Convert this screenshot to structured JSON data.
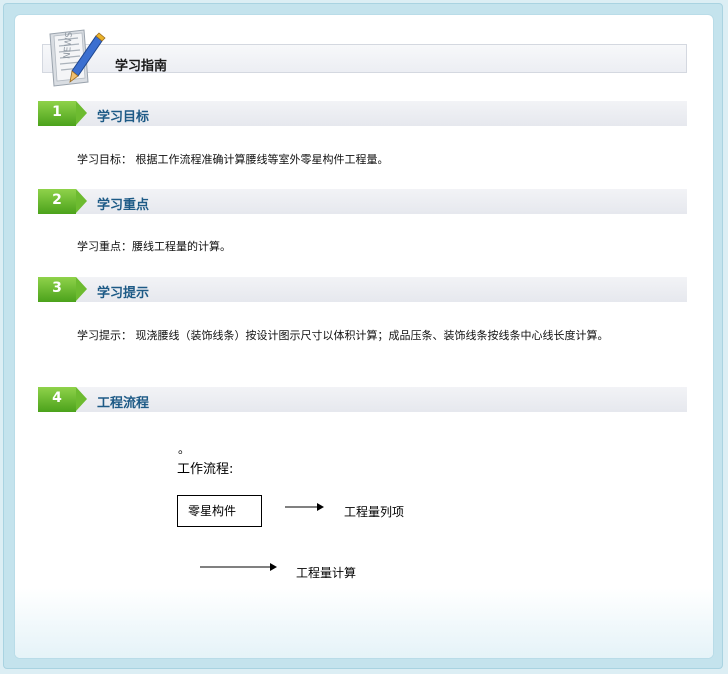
{
  "header": {
    "title": "学习指南",
    "icon": "news-pencil-icon"
  },
  "sections": [
    {
      "num": "1",
      "title": "学习目标",
      "text": "学习目标： 根据工作流程准确计算腰线等室外零星构件工程量。"
    },
    {
      "num": "2",
      "title": "学习重点",
      "text": "学习重点：腰线工程量的计算。"
    },
    {
      "num": "3",
      "title": "学习提示",
      "text": "学习提示： 现浇腰线（装饰线条）按设计图示尺寸以体积计算；成品压条、装饰线条按线条中心线长度计算。"
    },
    {
      "num": "4",
      "title": "工程流程",
      "text": ""
    }
  ],
  "flow": {
    "dot": "。",
    "label": "工作流程:",
    "box": "零星构件",
    "step1": "工程量列项",
    "step2": "工程量计算"
  },
  "colors": {
    "badge_green": "#6dbb30",
    "title_blue": "#1d5a86",
    "frame_blue": "#c4e3ed"
  }
}
